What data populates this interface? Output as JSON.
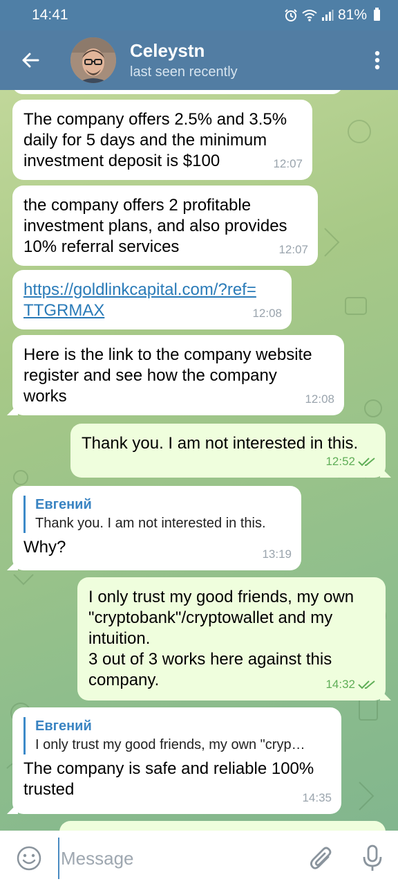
{
  "status_bar": {
    "time": "14:41",
    "battery": "81%",
    "icons": [
      "alarm-icon",
      "wifi-icon",
      "signal-icon",
      "battery-icon"
    ]
  },
  "header": {
    "title": "Celeystn",
    "subtitle": "last seen recently",
    "back_icon": "arrow-left-icon",
    "menu_icon": "more-vertical-icon",
    "bar_color": "#527da3"
  },
  "messages": [
    {
      "direction": "in",
      "text": "The company offers 2.5% and 3.5% daily for 5 days and the minimum investment deposit is $100",
      "lines": [
        "The company offers 2.5% and 3.5%",
        "daily for 5 days and the minimum",
        "investment deposit is $100"
      ],
      "time": "12:07"
    },
    {
      "direction": "in",
      "lines": [
        "the company offers 2 profitable",
        "investment plans, and also provides",
        "10% referral services"
      ],
      "time": "12:07"
    },
    {
      "direction": "in",
      "link_lines": [
        "https://goldlinkcapital.com/?ref=",
        "TTGRMAX"
      ],
      "time": "12:08"
    },
    {
      "direction": "in",
      "lines": [
        "Here is the link to the company website",
        "register and see how the company",
        "works"
      ],
      "time": "12:08"
    },
    {
      "direction": "out",
      "lines": [
        "Thank you. I am not interested in this."
      ],
      "time": "12:52",
      "read": true
    },
    {
      "direction": "in",
      "reply_author": "Евгений",
      "reply_text": "Thank you. I am not interested in this.",
      "lines": [
        "Why?"
      ],
      "time": "13:19"
    },
    {
      "direction": "out",
      "lines": [
        "I only trust my good friends, my own",
        "\"cryptobank\"/cryptowallet and my",
        "intuition.",
        "3 out of 3 works here against this",
        "company."
      ],
      "time": "14:32",
      "read": true
    },
    {
      "direction": "in",
      "reply_author": "Евгений",
      "reply_text": "I only trust my good friends, my own \"cryp…",
      "lines": [
        "The company is safe and reliable 100%",
        "trusted"
      ],
      "time": "14:35"
    }
  ],
  "input": {
    "placeholder": "Message",
    "value": "",
    "emoji_icon": "emoji-icon",
    "attach_icon": "paperclip-icon",
    "mic_icon": "microphone-icon"
  },
  "colors": {
    "incoming_bubble": "#ffffff",
    "outgoing_bubble": "#effedd",
    "link": "#2a7bb8",
    "reply_accent": "#3a84c2",
    "read_ticks": "#5fae57"
  }
}
